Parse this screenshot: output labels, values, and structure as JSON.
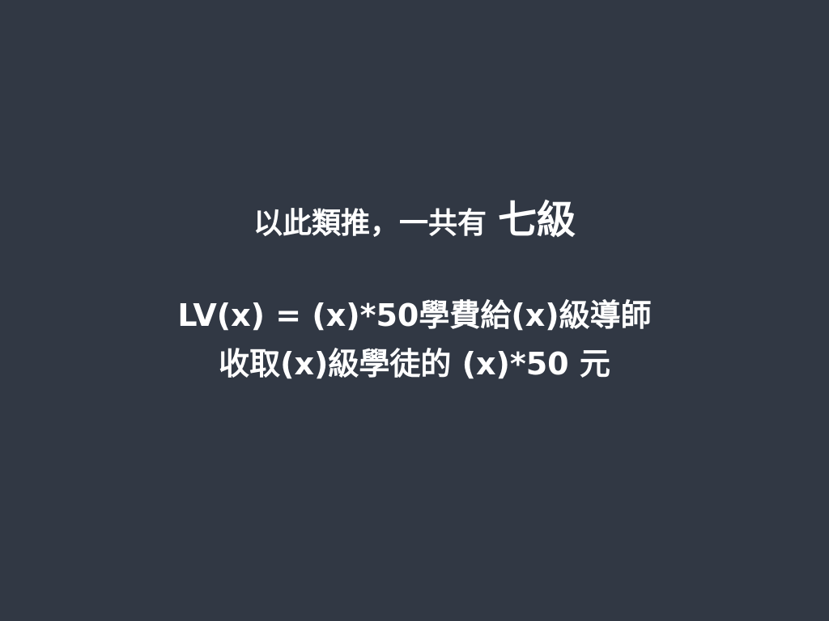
{
  "slide": {
    "heading": {
      "prefix": "以此類推，一共有",
      "emphasis": "七級"
    },
    "formula": {
      "line1": "LV(x) = (x)*50學費給(x)級導師",
      "line2": "收取(x)級學徒的 (x)*50 元"
    }
  }
}
